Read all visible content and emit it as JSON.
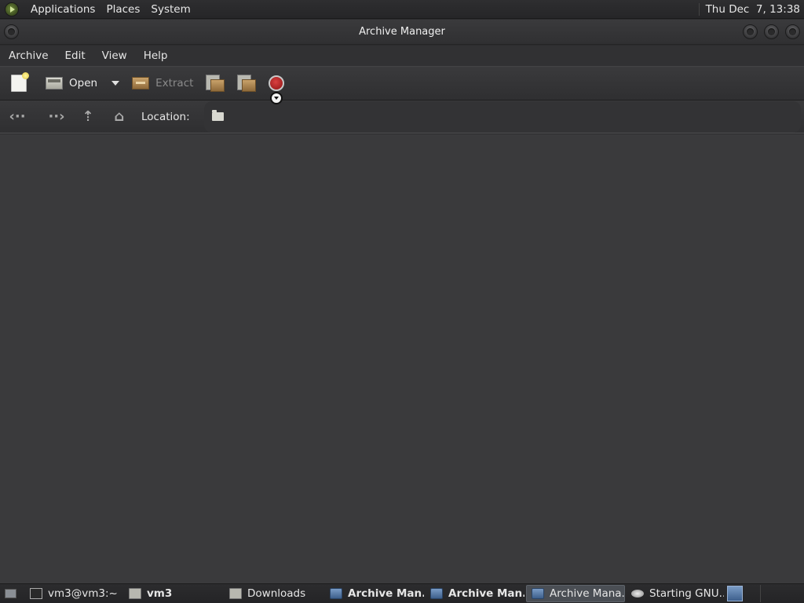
{
  "top_panel": {
    "menus": [
      "Applications",
      "Places",
      "System"
    ],
    "clock": "Thu Dec  7, 13:38"
  },
  "window": {
    "title": "Archive Manager"
  },
  "menubar": {
    "items": [
      "Archive",
      "Edit",
      "View",
      "Help"
    ]
  },
  "toolbar": {
    "open_label": "Open",
    "extract_label": "Extract"
  },
  "location": {
    "label": "Location:"
  },
  "taskbar": {
    "tasks": [
      {
        "label": "vm3@vm3:~",
        "icon": "terminal-icon",
        "bold": false,
        "active": false
      },
      {
        "label": "vm3",
        "icon": "folder-icon",
        "bold": true,
        "active": false
      },
      {
        "label": "Downloads",
        "icon": "folder-icon",
        "bold": false,
        "active": false
      },
      {
        "label": "Archive Man...",
        "icon": "archive-manager-icon",
        "bold": true,
        "active": false
      },
      {
        "label": "Archive Man...",
        "icon": "archive-manager-icon",
        "bold": true,
        "active": false
      },
      {
        "label": "Archive Mana...",
        "icon": "archive-manager-icon",
        "bold": false,
        "active": true
      },
      {
        "label": "Starting GNU...",
        "icon": "gnu-icon",
        "bold": false,
        "active": false
      }
    ]
  }
}
